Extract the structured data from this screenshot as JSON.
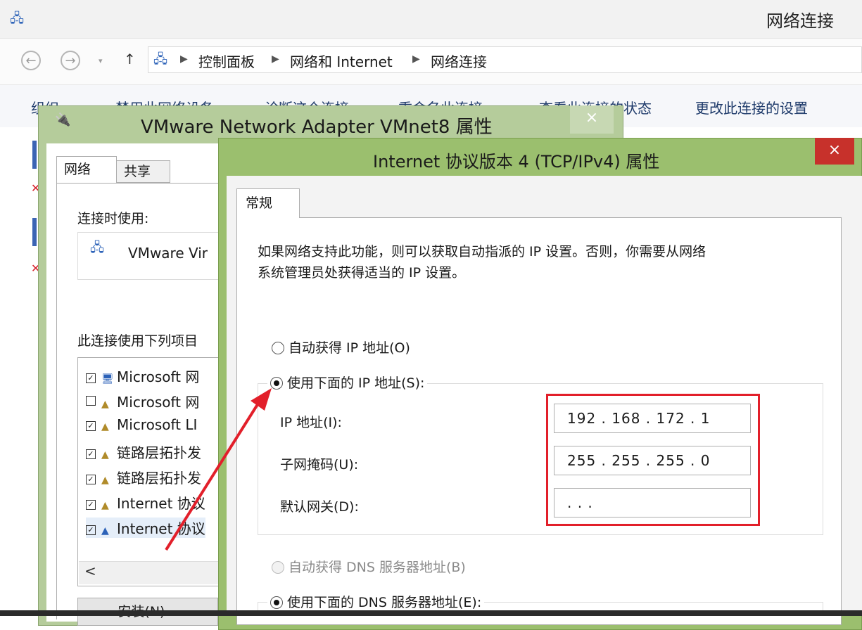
{
  "explorer": {
    "title": "网络连接",
    "breadcrumb": [
      "控制面板",
      "网络和 Internet",
      "网络连接"
    ],
    "commands": [
      "组织 ▾",
      "禁用此网络设备",
      "诊断这个连接",
      "重命名此连接",
      "查看此连接的状态",
      "更改此连接的设置"
    ]
  },
  "vm_dialog": {
    "title": "VMware Network Adapter VMnet8 属性",
    "close": "×",
    "tabs": [
      "网络",
      "共享"
    ],
    "connect_using_label": "连接时使用:",
    "adapter_name": "VMware Vir",
    "items_label": "此连接使用下列项目",
    "items": [
      {
        "checked": true,
        "label": "Microsoft 网"
      },
      {
        "checked": false,
        "label": "Microsoft 网"
      },
      {
        "checked": true,
        "label": "Microsoft LI"
      },
      {
        "checked": true,
        "label": "链路层拓扑发"
      },
      {
        "checked": true,
        "label": "链路层拓扑发"
      },
      {
        "checked": true,
        "label": "Internet 协议"
      },
      {
        "checked": true,
        "label": "Internet 协议"
      }
    ],
    "scroll_left": "<",
    "install_button": "安装(N)..."
  },
  "ip_dialog": {
    "title": "Internet 协议版本 4 (TCP/IPv4) 属性",
    "close": "×",
    "tab": "常规",
    "description_line1": "如果网络支持此功能，则可以获取自动指派的 IP 设置。否则，你需要从网络",
    "description_line2": "系统管理员处获得适当的 IP 设置。",
    "radio_auto_ip": "自动获得 IP 地址(O)",
    "radio_manual_ip": "使用下面的 IP 地址(S):",
    "ip_label": "IP 地址(I):",
    "ip_value": "192 . 168 . 172 .   1",
    "mask_label": "子网掩码(U):",
    "mask_value": "255 . 255 . 255 .   0",
    "gateway_label": "默认网关(D):",
    "gateway_value": "       .        .        .",
    "radio_auto_dns": "自动获得 DNS 服务器地址(B)",
    "radio_manual_dns": "使用下面的 DNS 服务器地址(E):"
  },
  "colors": {
    "highlight": "#e21f2a",
    "arrow": "#e21f2a",
    "ip_border": "#9bbf6e",
    "close_red": "#c7312b"
  }
}
